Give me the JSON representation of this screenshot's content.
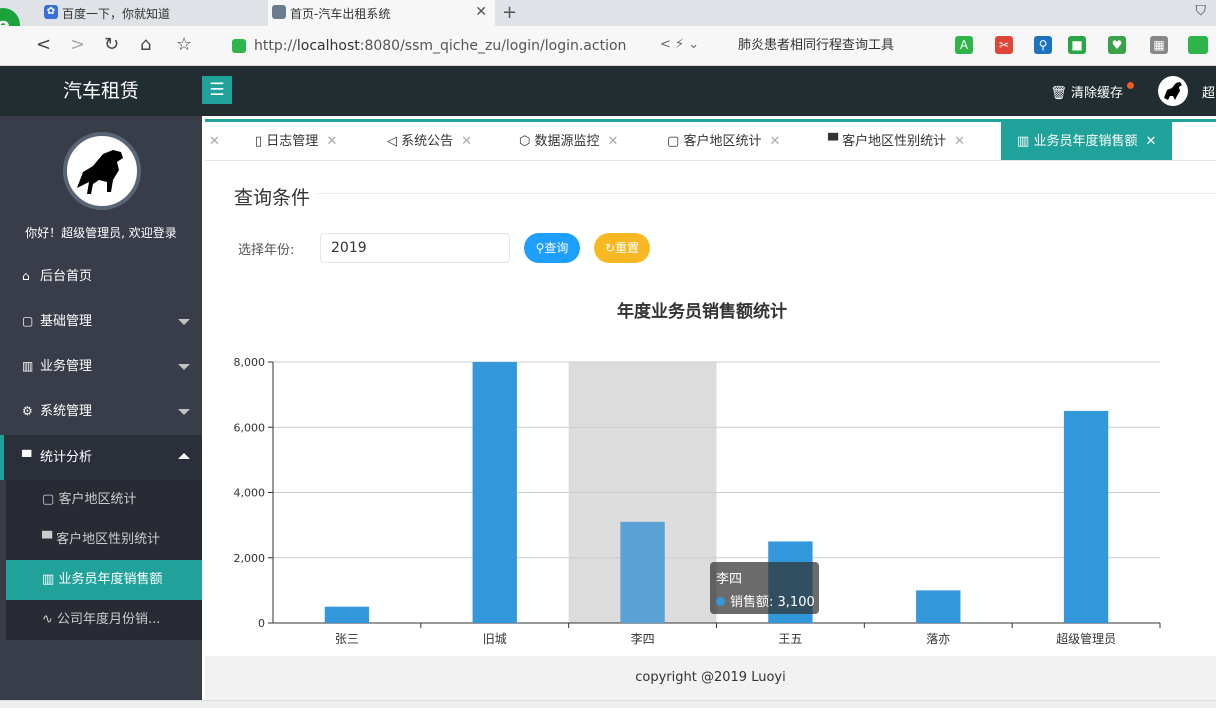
{
  "browser": {
    "tabs": [
      {
        "title": "百度一下，你就知道"
      },
      {
        "title": "首页-汽车出租系统"
      }
    ],
    "url_prefix": "http://",
    "url_host": "localhost",
    "url_rest": ":8080/ssm_qiche_zu/login/login.action",
    "search_text": "肺炎患者相同行程查询工具"
  },
  "header": {
    "brand": "汽车租赁",
    "menu_toggle": "☰",
    "clear_cache": "清除缓存",
    "user_initial": "超"
  },
  "sidebar": {
    "welcome": "你好！超级管理员, 欢迎登录",
    "items": [
      {
        "label": "后台首页",
        "icon": "⌂"
      },
      {
        "label": "基础管理",
        "icon": "▢"
      },
      {
        "label": "业务管理",
        "icon": "▥"
      },
      {
        "label": "系统管理",
        "icon": "⚙"
      },
      {
        "label": "统计分析",
        "icon": "▀"
      }
    ],
    "sub_items": [
      {
        "label": "客户地区统计",
        "icon": "▢"
      },
      {
        "label": "客户地区性别统计",
        "icon": "▀"
      },
      {
        "label": "业务员年度销售额",
        "icon": "▥"
      },
      {
        "label": "公司年度月份销...",
        "icon": "∿"
      }
    ]
  },
  "tabs": [
    {
      "label": "日志管理"
    },
    {
      "label": "系统公告"
    },
    {
      "label": "数据源监控"
    },
    {
      "label": "客户地区统计"
    },
    {
      "label": "客户地区性别统计"
    },
    {
      "label": "业务员年度销售额"
    }
  ],
  "query": {
    "title": "查询条件",
    "year_label": "选择年份:",
    "year_value": "2019",
    "search_button": "查询",
    "reset_button": "重置"
  },
  "chart_data": {
    "type": "bar",
    "title": "年度业务员销售额统计",
    "categories": [
      "张三",
      "旧城",
      "李四",
      "王五",
      "落亦",
      "超级管理员"
    ],
    "series": [
      {
        "name": "销售额",
        "values": [
          500,
          8000,
          3100,
          2500,
          1000,
          6500
        ]
      }
    ],
    "ylim": [
      0,
      8000
    ],
    "yticks": [
      "0",
      "2,000",
      "4,000",
      "6,000",
      "8,000"
    ],
    "highlight_index": 2,
    "color": "#3398db",
    "grid": true
  },
  "tooltip": {
    "name": "李四",
    "series": "销售额",
    "value": "3,100"
  },
  "footer": {
    "copyright": "copyright @2019 Luoyi"
  }
}
